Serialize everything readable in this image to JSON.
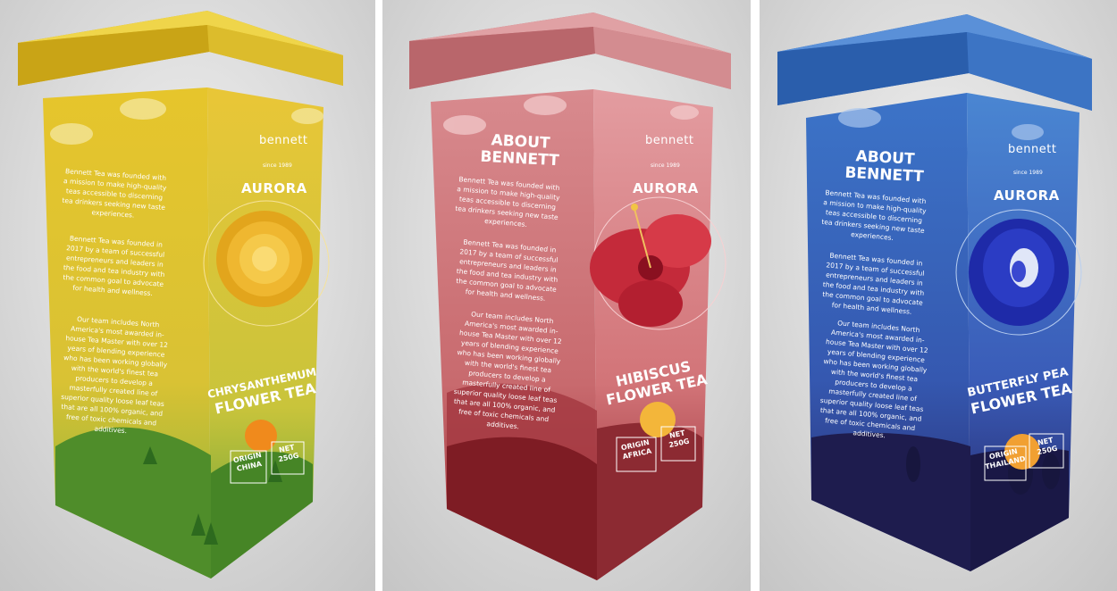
{
  "colors": {
    "background": "#d2d2d2",
    "yellow_box": "#e8c832",
    "pink_box": "#d98a8f",
    "blue_box": "#3a6fc4"
  },
  "boxes": [
    {
      "brand": "bennett",
      "since": "since 1989",
      "about_title": "",
      "aurora": "AURORA",
      "para1": "Bennett Tea was founded with a mission to make high-quality teas accessible to discerning tea drinkers seeking new taste experiences.",
      "para2": "Bennett Tea was founded in 2017 by a team of successful entrepreneurs and leaders in the food and tea industry with the common goal to advocate for health and wellness.",
      "para3": "Our team includes North America's most awarded in-house Tea Master with over 12 years of blending experience who has been working globally with the world's finest tea producers to develop a masterfully created line of superior quality loose leaf teas that are all 100% organic, and free of toxic chemicals and additives.",
      "product_line1": "CHRYSANTHEMUM",
      "product_line2": "FLOWER TEA",
      "origin_label": "ORIGIN",
      "origin_value": "CHINA",
      "net_label": "NET",
      "net_value": "250G",
      "flower_icon": "chrysanthemum-icon"
    },
    {
      "brand": "bennett",
      "since": "since 1989",
      "about_title": "ABOUT BENNETT",
      "aurora": "AURORA",
      "para1": "Bennett Tea was founded with a mission to make high-quality teas accessible to discerning tea drinkers seeking new taste experiences.",
      "para2": "Bennett Tea was founded in 2017 by a team of successful entrepreneurs and leaders in the food and tea industry with the common goal to advocate for health and wellness.",
      "para3": "Our team includes North America's most awarded in-house Tea Master with over 12 years of blending experience who has been working globally with the world's finest tea producers to develop a masterfully created line of superior quality loose leaf teas that are all 100% organic, and free of toxic chemicals and additives.",
      "product_line1": "HIBISCUS",
      "product_line2": "FLOWER TEA",
      "origin_label": "ORIGIN",
      "origin_value": "AFRICA",
      "net_label": "NET",
      "net_value": "250G",
      "flower_icon": "hibiscus-icon"
    },
    {
      "brand": "bennett",
      "since": "since 1989",
      "about_title": "ABOUT BENNETT",
      "aurora": "AURORA",
      "para1": "Bennett Tea was founded with a mission to make high-quality teas accessible to discerning tea drinkers seeking new taste experiences.",
      "para2": "Bennett Tea was founded in 2017 by a team of successful entrepreneurs and leaders in the food and tea industry with the common goal to advocate for health and wellness.",
      "para3": "Our team includes North America's most awarded in-house Tea Master with over 12 years of blending experience who has been working globally with the world's finest tea producers to develop a masterfully created line of superior quality loose leaf teas that are all 100% organic, and free of toxic chemicals and additives.",
      "product_line1": "BUTTERFLY PEA",
      "product_line2": "FLOWER TEA",
      "origin_label": "ORIGIN",
      "origin_value": "THAILAND",
      "net_label": "NET",
      "net_value": "250G",
      "flower_icon": "butterfly-pea-icon"
    }
  ]
}
